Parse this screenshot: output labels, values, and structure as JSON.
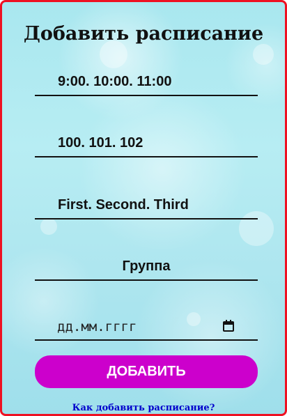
{
  "form": {
    "title": "Добавить расписание",
    "times_value": "9:00. 10:00. 11:00",
    "rooms_value": "100. 101. 102",
    "names_value": "First. Second. Third",
    "group_placeholder": "Группа",
    "date_placeholder": "дд.мм.гггг",
    "date_icon": "calendar-icon",
    "submit_label": "ДОБАВИТЬ",
    "help_link": "Как добавить расписание?"
  },
  "colors": {
    "border": "#ee1122",
    "button": "#cc00cc",
    "link": "#0000cc"
  }
}
